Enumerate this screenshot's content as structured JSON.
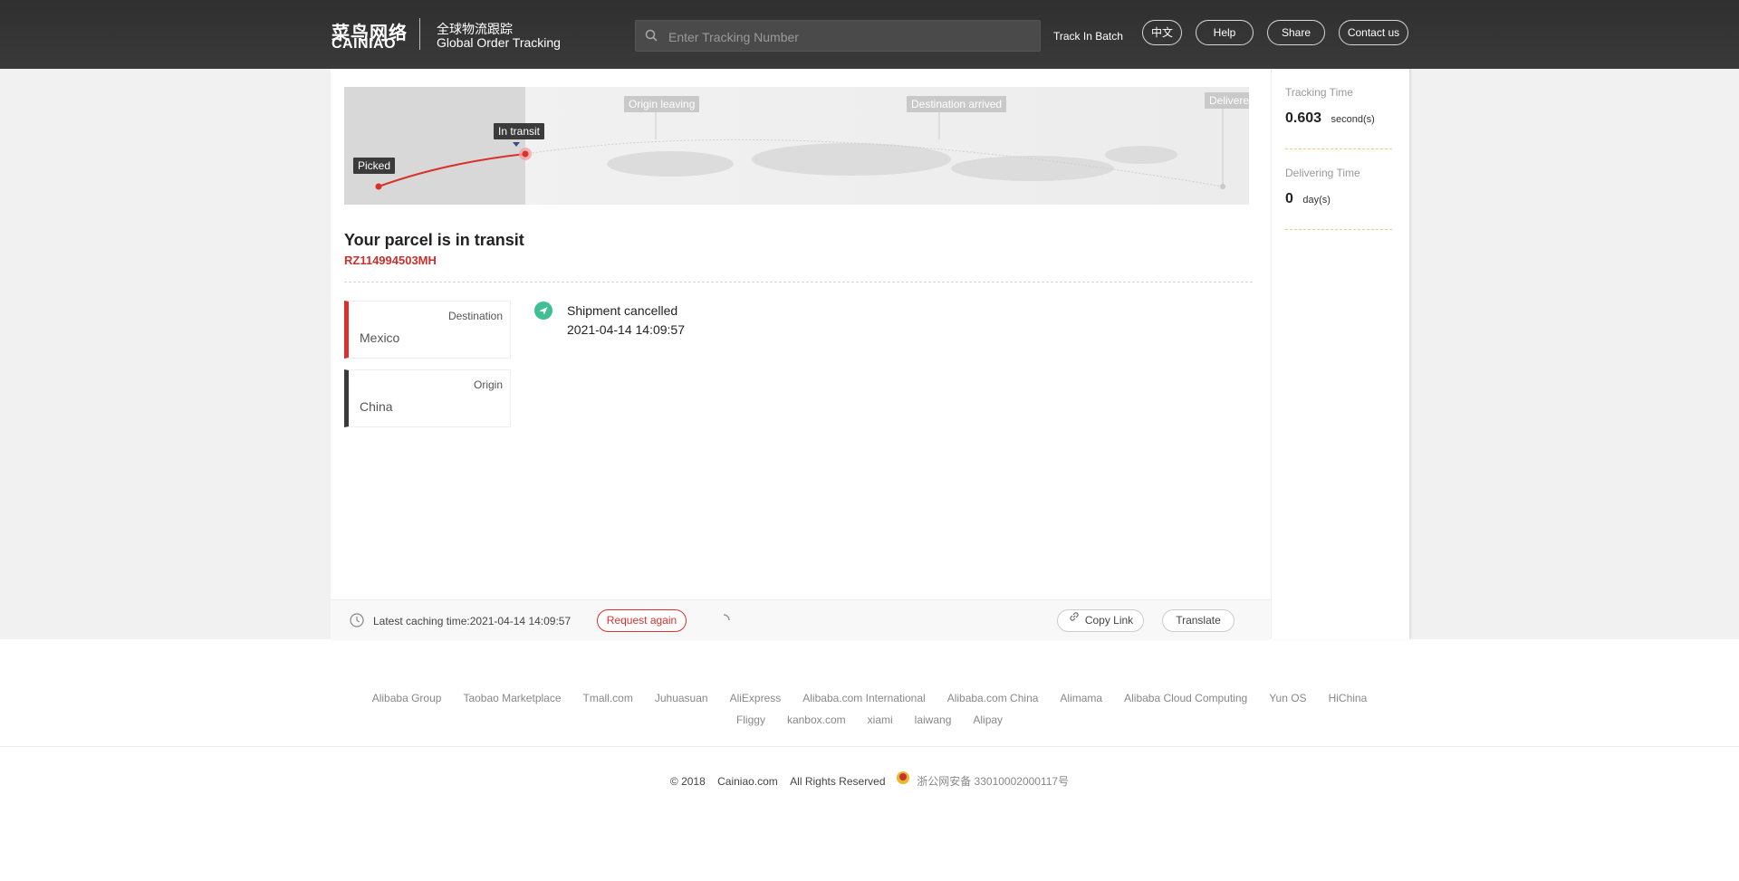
{
  "header": {
    "logo_cn": "菜鸟网络",
    "logo_en": "CAINIAO",
    "subtitle_cn": "全球物流跟踪",
    "subtitle_en": "Global Order Tracking",
    "search_placeholder": "Enter Tracking Number",
    "batch_label": "Track In Batch",
    "buttons": {
      "lang": "中文",
      "help": "Help",
      "share": "Share",
      "contact": "Contact us"
    }
  },
  "progress": {
    "stages": [
      "Picked",
      "In transit",
      "Origin leaving",
      "Destination arrived",
      "Delivere"
    ],
    "current_stage": "In transit",
    "colors": {
      "active": "#d9312b",
      "inactive": "#c9c9c9"
    }
  },
  "parcel": {
    "status_title": "Your parcel is in transit",
    "tracking_number": "RZ114994503MH",
    "destination_label": "Destination",
    "destination_value": "Mexico",
    "origin_label": "Origin",
    "origin_value": "China"
  },
  "events": [
    {
      "title": "Shipment cancelled",
      "time": "2021-04-14 14:09:57",
      "icon": "airplane-icon"
    }
  ],
  "side": {
    "tracking_time_label": "Tracking Time",
    "tracking_time_value": "0.603",
    "tracking_time_unit": "second(s)",
    "delivering_time_label": "Delivering Time",
    "delivering_time_value": "0",
    "delivering_time_unit": "day(s)"
  },
  "bottombar": {
    "cache_text": "Latest caching time:2021-04-14 14:09:57",
    "request_again": "Request again",
    "copy_link": "Copy Link",
    "translate": "Translate"
  },
  "footer": {
    "links_row1": [
      "Alibaba Group",
      "Taobao Marketplace",
      "Tmall.com",
      "Juhuasuan",
      "AliExpress",
      "Alibaba.com International",
      "Alibaba.com China",
      "Alimama",
      "Alibaba Cloud Computing",
      "Yun OS",
      "HiChina"
    ],
    "links_row2": [
      "Fliggy",
      "kanbox.com",
      "xiami",
      "laiwang",
      "Alipay"
    ],
    "copyright_year": "© 2018",
    "copyright_site": "Cainiao.com",
    "copyright_rights": "All Rights Reserved",
    "icp": "浙公网安备 33010002000117号"
  }
}
